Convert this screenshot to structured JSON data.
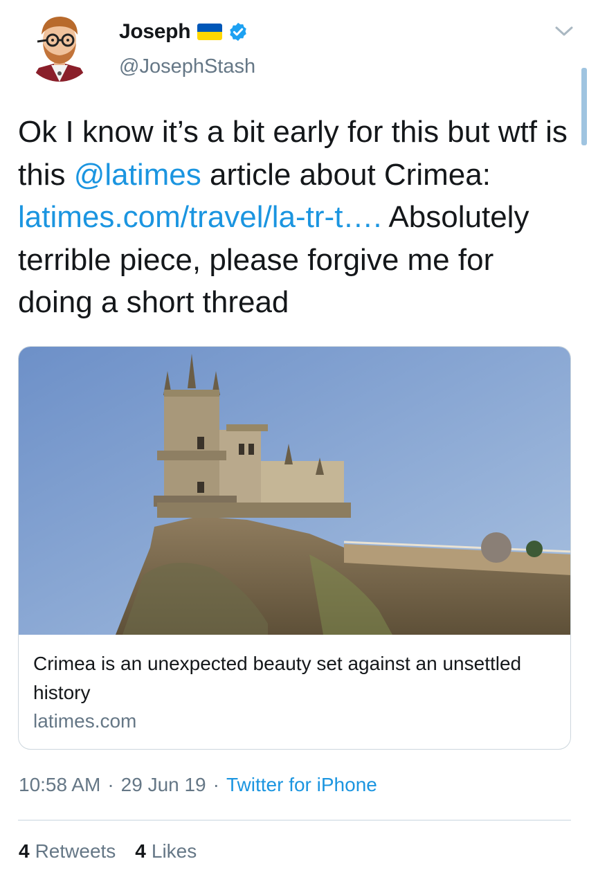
{
  "author": {
    "display_name": "Joseph",
    "handle": "@JosephStash",
    "flag_icon": "ukraine-flag-icon",
    "flag_colors": [
      "#0057b8",
      "#ffd700"
    ],
    "verified_icon": "verified-badge-icon",
    "verified_color": "#1da1f2"
  },
  "tweet": {
    "text_parts": [
      {
        "type": "text",
        "value": "Ok I know it’s a bit early for this but wtf is this "
      },
      {
        "type": "mention",
        "value": "@latimes"
      },
      {
        "type": "text",
        "value": " article about Crimea: "
      },
      {
        "type": "link",
        "value": "latimes.com/travel/la-tr-t…."
      },
      {
        "type": "text",
        "value": " Absolutely terrible piece, please forgive me for doing a short thread"
      }
    ]
  },
  "card": {
    "image_icon": "castle-photo",
    "title": "Crimea is an unexpected beauty set against an unsettled history",
    "domain": "latimes.com"
  },
  "meta": {
    "time": "10:58 AM",
    "date": "29 Jun 19",
    "source": "Twitter for iPhone",
    "separator": "·"
  },
  "stats": {
    "retweets_count": "4",
    "retweets_label": "Retweets",
    "likes_count": "4",
    "likes_label": "Likes"
  },
  "colors": {
    "link": "#1b95e0",
    "secondary_text": "#657786",
    "primary_text": "#14171a",
    "border": "#ccd6dd"
  }
}
